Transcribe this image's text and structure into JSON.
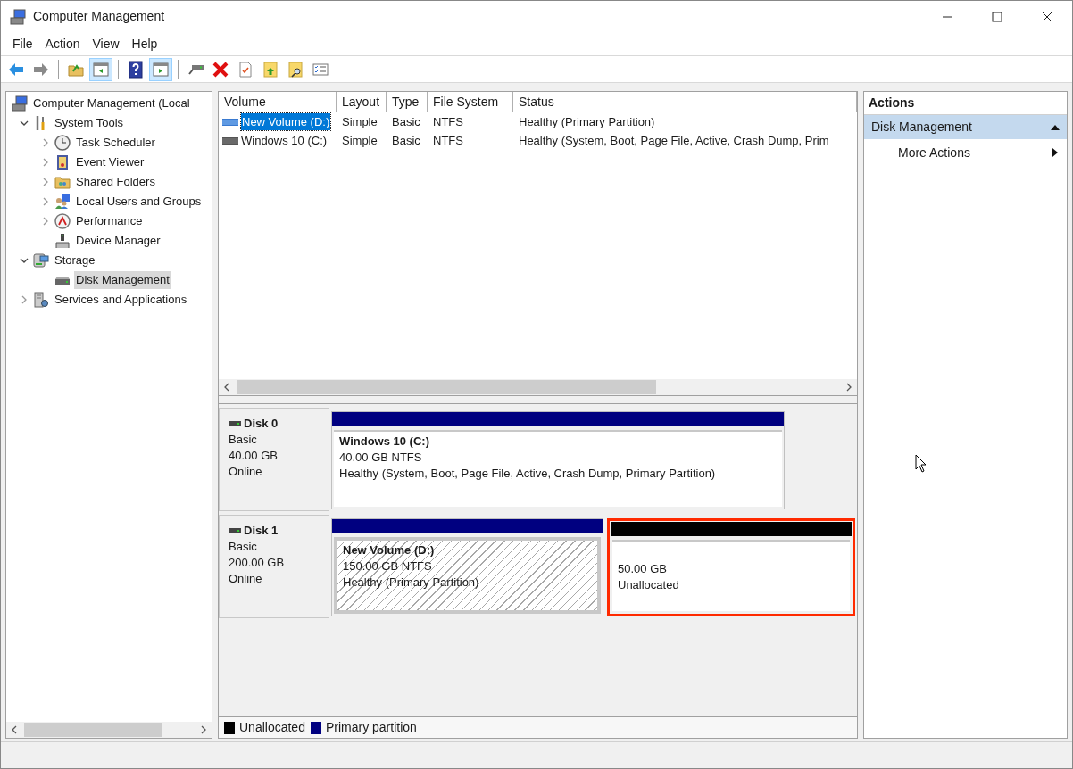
{
  "window": {
    "title": "Computer Management"
  },
  "menu": [
    "File",
    "Action",
    "View",
    "Help"
  ],
  "toolbar": [
    [
      {
        "kind": "back",
        "pressed": false,
        "disabled": false
      },
      {
        "kind": "forward",
        "pressed": false,
        "disabled": true
      }
    ],
    [
      {
        "kind": "folder_up",
        "pressed": false,
        "disabled": false
      },
      {
        "kind": "console_tree",
        "pressed": true,
        "disabled": false
      }
    ],
    [
      {
        "kind": "help",
        "pressed": false,
        "disabled": false
      },
      {
        "kind": "action_pane",
        "pressed": true,
        "disabled": false
      }
    ],
    [
      {
        "kind": "connect",
        "pressed": false,
        "disabled": false
      },
      {
        "kind": "delete",
        "pressed": false,
        "disabled": false
      },
      {
        "kind": "properties",
        "pressed": false,
        "disabled": false
      },
      {
        "kind": "folder_arrow",
        "pressed": false,
        "disabled": false
      },
      {
        "kind": "folder_search",
        "pressed": false,
        "disabled": false
      },
      {
        "kind": "checklist",
        "pressed": false,
        "disabled": false
      }
    ]
  ],
  "tree": [
    {
      "label": "Computer Management (Local",
      "kind": "computer",
      "selected": false,
      "children": [
        {
          "label": "System Tools",
          "kind": "tools",
          "expanded": true,
          "selected": false,
          "children": [
            {
              "label": "Task Scheduler",
              "kind": "clock",
              "expanded": false,
              "selected": false
            },
            {
              "label": "Event Viewer",
              "kind": "event",
              "expanded": false,
              "selected": false
            },
            {
              "label": "Shared Folders",
              "kind": "shared",
              "expanded": false,
              "selected": false
            },
            {
              "label": "Local Users and Groups",
              "kind": "users",
              "expanded": false,
              "selected": false
            },
            {
              "label": "Performance",
              "kind": "performance",
              "expanded": false,
              "selected": false
            },
            {
              "label": "Device Manager",
              "kind": "device",
              "selected": false
            }
          ]
        },
        {
          "label": "Storage",
          "kind": "storage",
          "expanded": true,
          "selected": false,
          "children": [
            {
              "label": "Disk Management",
              "kind": "disk",
              "selected": true
            }
          ]
        },
        {
          "label": "Services and Applications",
          "kind": "services",
          "expanded": false,
          "selected": false
        }
      ]
    }
  ],
  "volumes": {
    "columns": [
      "Volume",
      "Layout",
      "Type",
      "File System",
      "Status"
    ],
    "rows": [
      {
        "selected": true,
        "cells": [
          "New Volume (D:)",
          "Simple",
          "Basic",
          "NTFS",
          "Healthy (Primary Partition)"
        ]
      },
      {
        "selected": false,
        "cells": [
          "Windows 10 (C:)",
          "Simple",
          "Basic",
          "NTFS",
          "Healthy (System, Boot, Page File, Active, Crash Dump, Prim"
        ]
      }
    ]
  },
  "disks": [
    {
      "name": "Disk 0",
      "type": "Basic",
      "size": "40.00 GB",
      "status": "Online",
      "partitions": [
        {
          "kind": "primary",
          "title": "Windows 10  (C:)",
          "size": "40.00 GB NTFS",
          "status": "Healthy (System, Boot, Page File, Active, Crash Dump, Primary Partition)",
          "selected": false,
          "highlighted": false
        }
      ]
    },
    {
      "name": "Disk 1",
      "type": "Basic",
      "size": "200.00 GB",
      "status": "Online",
      "partitions": [
        {
          "kind": "primary",
          "title": "New Volume  (D:)",
          "size": "150.00 GB NTFS",
          "status": "Healthy (Primary Partition)",
          "selected": true,
          "highlighted": false
        },
        {
          "kind": "unallocated",
          "size": "50.00 GB",
          "status": "Unallocated",
          "selected": false,
          "highlighted": true
        }
      ]
    }
  ],
  "legend": [
    {
      "label": "Unallocated",
      "color": "#000000"
    },
    {
      "label": "Primary partition",
      "color": "#000080"
    }
  ],
  "actions": {
    "header": "Actions",
    "sections": [
      {
        "title": "Disk Management",
        "expanded": true,
        "items": [
          {
            "label": "More Actions",
            "submenu": true
          }
        ]
      }
    ]
  }
}
